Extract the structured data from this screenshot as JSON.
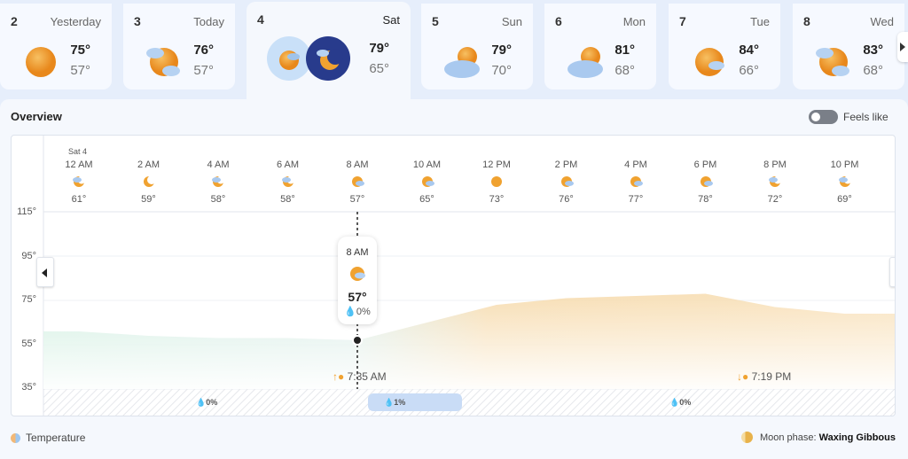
{
  "days": [
    {
      "num": "2",
      "name": "Yesterday",
      "hi": "75°",
      "lo": "57°",
      "icon": "sun-icon"
    },
    {
      "num": "3",
      "name": "Today",
      "hi": "76°",
      "lo": "57°",
      "icon": "partly-cloudy-icon"
    },
    {
      "num": "4",
      "name": "Sat",
      "hi": "79°",
      "lo": "65°",
      "icon": "day-night-icon",
      "selected": true
    },
    {
      "num": "5",
      "name": "Sun",
      "hi": "79°",
      "lo": "70°",
      "icon": "cloudy-sun-icon"
    },
    {
      "num": "6",
      "name": "Mon",
      "hi": "81°",
      "lo": "68°",
      "icon": "cloudy-sun-icon"
    },
    {
      "num": "7",
      "name": "Tue",
      "hi": "84°",
      "lo": "66°",
      "icon": "partly-cloudy-icon"
    },
    {
      "num": "8",
      "name": "Wed",
      "hi": "83°",
      "lo": "68°",
      "icon": "partly-cloudy-icon"
    }
  ],
  "overview": {
    "title": "Overview",
    "feels_like": "Feels like"
  },
  "chart": {
    "date_label": "Sat 4",
    "hours": [
      {
        "time": "12 AM",
        "temp": "61°",
        "icon": "night-cloudy-icon"
      },
      {
        "time": "2 AM",
        "temp": "59°",
        "icon": "moon-icon"
      },
      {
        "time": "4 AM",
        "temp": "58°",
        "icon": "night-cloudy-icon"
      },
      {
        "time": "6 AM",
        "temp": "58°",
        "icon": "night-cloudy-icon"
      },
      {
        "time": "8 AM",
        "temp": "57°",
        "icon": "partly-cloudy-icon"
      },
      {
        "time": "10 AM",
        "temp": "65°",
        "icon": "partly-cloudy-icon"
      },
      {
        "time": "12 PM",
        "temp": "73°",
        "icon": "sun-icon"
      },
      {
        "time": "2 PM",
        "temp": "76°",
        "icon": "partly-cloudy-icon"
      },
      {
        "time": "4 PM",
        "temp": "77°",
        "icon": "partly-cloudy-icon"
      },
      {
        "time": "6 PM",
        "temp": "78°",
        "icon": "partly-cloudy-icon"
      },
      {
        "time": "8 PM",
        "temp": "72°",
        "icon": "night-cloudy-icon"
      },
      {
        "time": "10 PM",
        "temp": "69°",
        "icon": "night-cloudy-icon"
      }
    ],
    "y_ticks": [
      "115°",
      "95°",
      "75°",
      "55°",
      "35°"
    ],
    "ylim": [
      35,
      115
    ],
    "series": [
      61,
      59,
      58,
      58,
      57,
      65,
      73,
      76,
      77,
      78,
      72,
      69
    ],
    "tooltip": {
      "time": "8 AM",
      "temp": "57°",
      "precip": "0%"
    },
    "sunrise": "7:35 AM",
    "sunset": "7:19 PM",
    "precip": [
      {
        "label": "0%"
      },
      {
        "label": "1%"
      },
      {
        "label": "0%"
      }
    ]
  },
  "legend": {
    "temperature": "Temperature",
    "moon_prefix": "Moon phase: ",
    "moon_phase": "Waxing Gibbous"
  },
  "colors": {
    "sun": "#f0a230",
    "cloud": "#a9c9ef",
    "night": "#283b8c",
    "warm": "#f6d9a9",
    "cool": "#cdeede"
  }
}
